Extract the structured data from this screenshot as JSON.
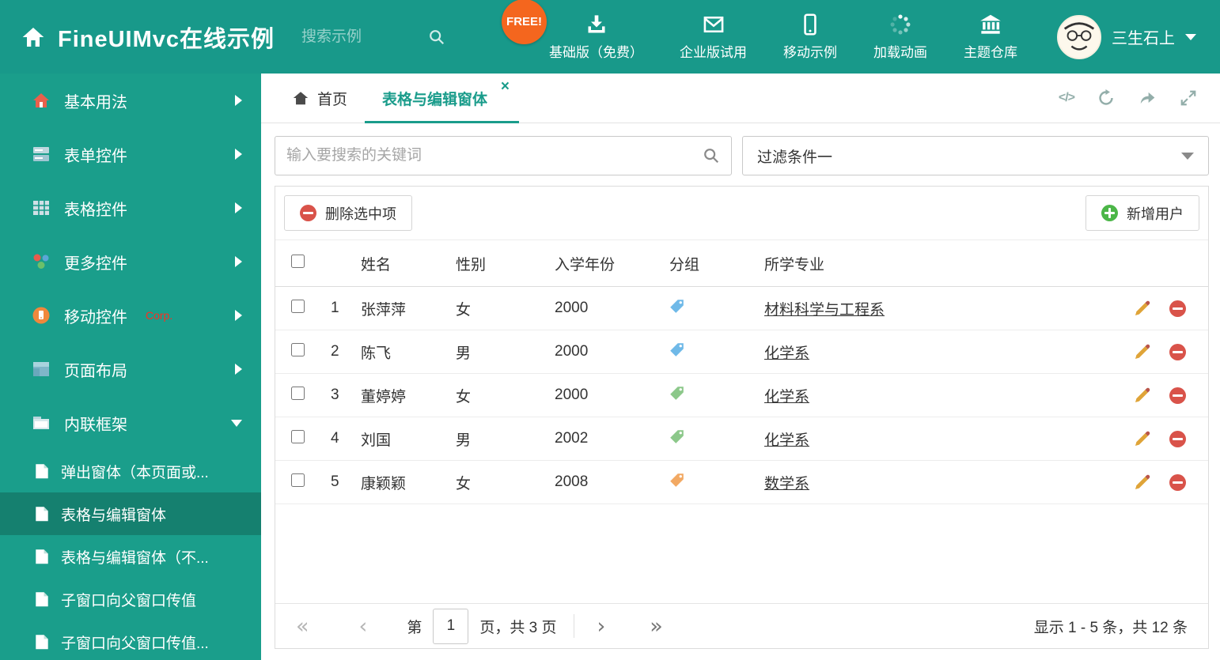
{
  "colors": {
    "teal": "#1a9c8b",
    "header_bg": "#18998a",
    "sidebar_bg": "#1a9e8b",
    "sidebar_active_bg": "#15806f",
    "free_badge_bg": "#f4661e",
    "delete_red": "#d9534a",
    "add_green": "#4cb648",
    "pencil_gold": "#dfa438",
    "corp_red": "#ff2d1f"
  },
  "header": {
    "title": "FineUIMvc在线示例",
    "search_placeholder": "搜索示例",
    "free_badge": "FREE!",
    "nav": [
      {
        "label": "基础版（免费）",
        "icon": "download-icon"
      },
      {
        "label": "企业版试用",
        "icon": "envelope-icon"
      },
      {
        "label": "移动示例",
        "icon": "mobile-icon"
      },
      {
        "label": "加载动画",
        "icon": "spinner-icon"
      },
      {
        "label": "主题仓库",
        "icon": "bank-icon"
      }
    ],
    "user_name": "三生石上"
  },
  "sidebar": {
    "items": [
      {
        "label": "基本用法",
        "icon": "home-icon",
        "state": "collapsed"
      },
      {
        "label": "表单控件",
        "icon": "form-icon",
        "state": "collapsed"
      },
      {
        "label": "表格控件",
        "icon": "table-icon",
        "state": "collapsed"
      },
      {
        "label": "更多控件",
        "icon": "widgets-icon",
        "state": "collapsed"
      },
      {
        "label": "移动控件",
        "badge": "Corp.",
        "icon": "mobile-badge-icon",
        "state": "collapsed"
      },
      {
        "label": "页面布局",
        "icon": "layout-icon",
        "state": "collapsed"
      },
      {
        "label": "内联框架",
        "icon": "iframe-icon",
        "state": "expanded"
      }
    ],
    "subitems": [
      {
        "label": "弹出窗体（本页面或...",
        "active": false
      },
      {
        "label": "表格与编辑窗体",
        "active": true
      },
      {
        "label": "表格与编辑窗体（不...",
        "active": false
      },
      {
        "label": "子窗口向父窗口传值",
        "active": false
      },
      {
        "label": "子窗口向父窗口传值...",
        "active": false
      }
    ]
  },
  "tabs": [
    {
      "label": "首页",
      "active": false
    },
    {
      "label": "表格与编辑窗体",
      "active": true,
      "closable": true
    }
  ],
  "filterbar": {
    "search_placeholder": "输入要搜索的关键词",
    "filter_value": "过滤条件一"
  },
  "toolbar": {
    "delete_label": "删除选中项",
    "add_label": "新增用户"
  },
  "table": {
    "headers": [
      "姓名",
      "性别",
      "入学年份",
      "分组",
      "所学专业"
    ],
    "rows": [
      {
        "num": "1",
        "name": "张萍萍",
        "gender": "女",
        "year": "2000",
        "tag_color": "#6fb9e8",
        "major": "材料科学与工程系"
      },
      {
        "num": "2",
        "name": "陈飞",
        "gender": "男",
        "year": "2000",
        "tag_color": "#6fb9e8",
        "major": "化学系"
      },
      {
        "num": "3",
        "name": "董婷婷",
        "gender": "女",
        "year": "2000",
        "tag_color": "#8cc88a",
        "major": "化学系"
      },
      {
        "num": "4",
        "name": "刘国",
        "gender": "男",
        "year": "2002",
        "tag_color": "#8cc88a",
        "major": "化学系"
      },
      {
        "num": "5",
        "name": "康颖颖",
        "gender": "女",
        "year": "2008",
        "tag_color": "#f2a963",
        "major": "数学系"
      }
    ]
  },
  "pagination": {
    "first": "«",
    "prev": "‹",
    "next": "›",
    "last": "»",
    "label_page": "第",
    "page_value": "1",
    "label_total": "页，共 3 页",
    "summary": "显示 1 - 5 条，共 12 条"
  },
  "icons": {
    "close": "×",
    "code": "</>"
  }
}
